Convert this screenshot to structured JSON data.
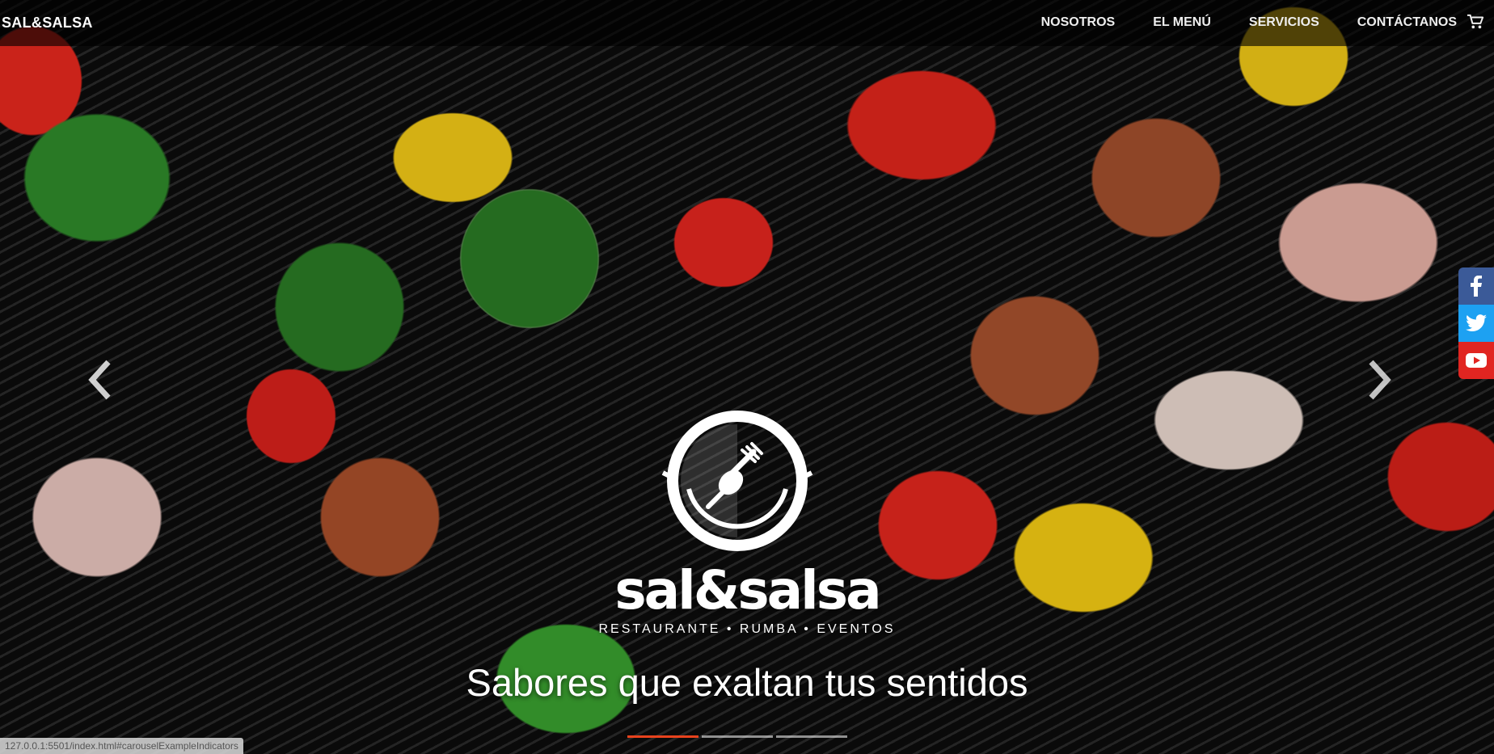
{
  "brand": "SAL&SALSA",
  "nav": {
    "links": [
      "NOSOTROS",
      "EL MENÚ",
      "SERVICIOS",
      "CONTÁCTANOS"
    ],
    "cart_icon": "shopping-cart-icon"
  },
  "carousel": {
    "prev_icon": "chevron-left-icon",
    "next_icon": "chevron-right-icon",
    "caption": "Sabores que exaltan tus sentidos",
    "slides_count": 3,
    "active_index": 0
  },
  "logo": {
    "wordmark": "sal&salsa",
    "tagline": "RESTAURANTE • RUMBA • EVENTOS"
  },
  "social": [
    "facebook-icon",
    "twitter-icon",
    "youtube-icon"
  ],
  "status_url": "127.0.0.1:5501/index.html#carouselExampleIndicators",
  "colors": {
    "nav_bg": "#000000",
    "indicator_active": "#e8421d",
    "facebook": "#3b5a98",
    "twitter": "#1da1f2",
    "youtube": "#e12521"
  }
}
